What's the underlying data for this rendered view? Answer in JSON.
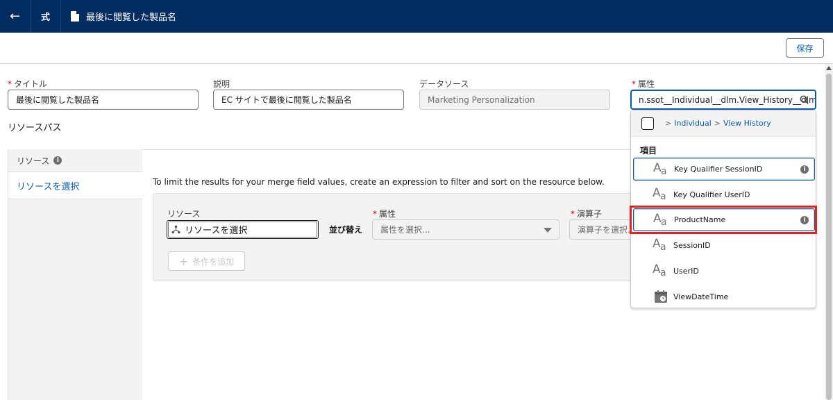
{
  "nav": {
    "back_icon": "arrow-left-icon",
    "formula_label": "式",
    "doc_icon": "document-icon",
    "title": "最後に閲覧した製品名"
  },
  "toolbar": {
    "save_label": "保存"
  },
  "fields": {
    "title": {
      "required_mark": "*",
      "label": "タイトル",
      "value": "最後に閲覧した製品名"
    },
    "description": {
      "label": "説明",
      "value": "EC サイトで最後に閲覧した製品名"
    },
    "data_source": {
      "label": "データソース",
      "value": "Marketing Personalization"
    },
    "attribute": {
      "required_mark": "*",
      "label": "属性",
      "value": "n.ssot__Individual__dlm.View_History__dlm."
    }
  },
  "resource_path_label": "リソースパス",
  "sidebar": {
    "header": "リソース",
    "item": "リソースを選択"
  },
  "main": {
    "limit_text": "To limit the results for your merge field values, create an expression to filter and sort on the resource below.",
    "filter": {
      "resource_label": "リソース",
      "resource_value": "リソースを選択",
      "sort_label": "並び替え",
      "attribute_required": "*",
      "attribute_label": "属性",
      "attribute_placeholder": "属性を選択...",
      "operator_required": "*",
      "operator_label": "演算子",
      "operator_placeholder": "演算子を選択...",
      "add_condition": "条件を追加"
    }
  },
  "dropdown": {
    "breadcrumb": {
      "sep1": ">",
      "link1": "Individual",
      "sep2": ">",
      "link2": "View History"
    },
    "group_label": "項目",
    "items": [
      {
        "label": "Key Qualifier SessionID",
        "icon": "text-field-icon",
        "info": "i"
      },
      {
        "label": "Key Qualifier UserID",
        "icon": "text-field-icon"
      },
      {
        "label": "ProductName",
        "icon": "text-field-icon",
        "info": "i"
      },
      {
        "label": "SessionID",
        "icon": "text-field-icon"
      },
      {
        "label": "UserID",
        "icon": "text-field-icon"
      },
      {
        "label": "ViewDateTime",
        "icon": "datetime-icon"
      }
    ]
  },
  "colors": {
    "nav_bg": "#032d60",
    "brand": "#0b5cab",
    "highlight_box": "#e3231f"
  }
}
